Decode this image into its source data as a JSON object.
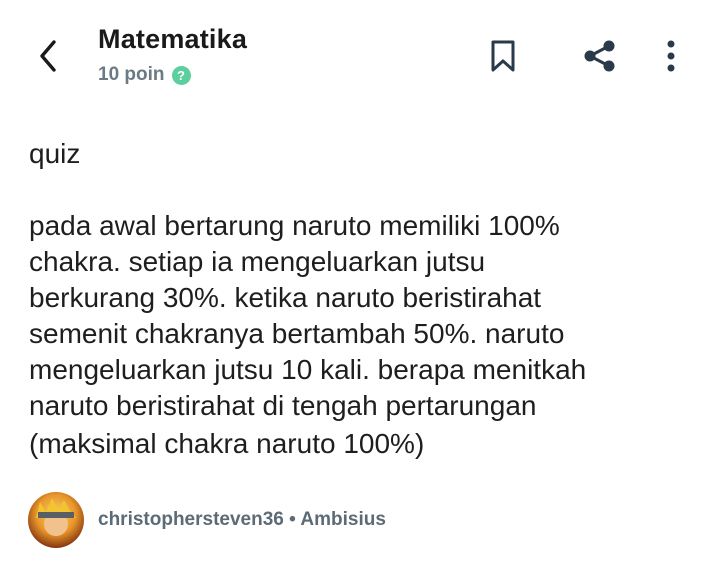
{
  "header": {
    "title": "Matematika",
    "points": "10 poin",
    "help_glyph": "?",
    "icons": [
      "back-arrow-icon",
      "bookmark-icon",
      "share-icon",
      "more-vertical-icon"
    ]
  },
  "question": {
    "label": "quiz",
    "lines": [
      "pada awal bertarung naruto memiliki 100%",
      "chakra. setiap ia mengeluarkan jutsu",
      "berkurang 30%. ketika naruto beristirahat",
      "semenit chakranya bertambah 50%. naruto",
      "mengeluarkan jutsu 10 kali. berapa menitkah",
      "naruto beristirahat di tengah pertarungan",
      "(maksimal chakra naruto 100%)"
    ]
  },
  "author": {
    "username": "christophersteven36",
    "separator": "•",
    "rank": "Ambisius"
  },
  "colors": {
    "accent_green": "#5ccf9e",
    "muted_text": "#6b7a85",
    "icon_dark": "#2b3a4a"
  }
}
